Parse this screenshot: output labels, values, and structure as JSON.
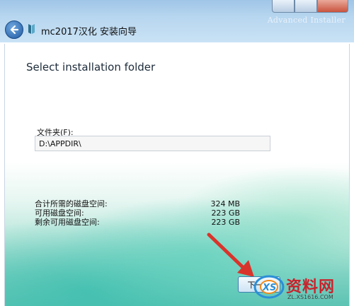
{
  "window": {
    "title": "mc2017汉化 安装向导",
    "brand_text": "Advanced Installer"
  },
  "page": {
    "heading": "Select installation folder"
  },
  "folder": {
    "label": "文件夹(F):",
    "value": "D:\\APPDIR\\"
  },
  "disk_space": [
    {
      "label": "合计所需的磁盘空间:",
      "value": "324 MB"
    },
    {
      "label": "可用磁盘空间:",
      "value": "223 GB"
    },
    {
      "label": "剩余可用磁盘空间:",
      "value": "223 GB"
    }
  ],
  "buttons": {
    "next_label": "下一步"
  },
  "watermark": {
    "name": "资料网",
    "url": "ZL.XS1616.COM",
    "logo_text": "XS"
  },
  "colors": {
    "arrow": "#d9342b",
    "watermark_red": "#c8232c",
    "teal_background": "#5cc3b3"
  },
  "icons": [
    "back-arrow-icon",
    "app-icon",
    "minimize-icon",
    "maximize-icon",
    "close-icon",
    "red-arrow-annotation"
  ]
}
